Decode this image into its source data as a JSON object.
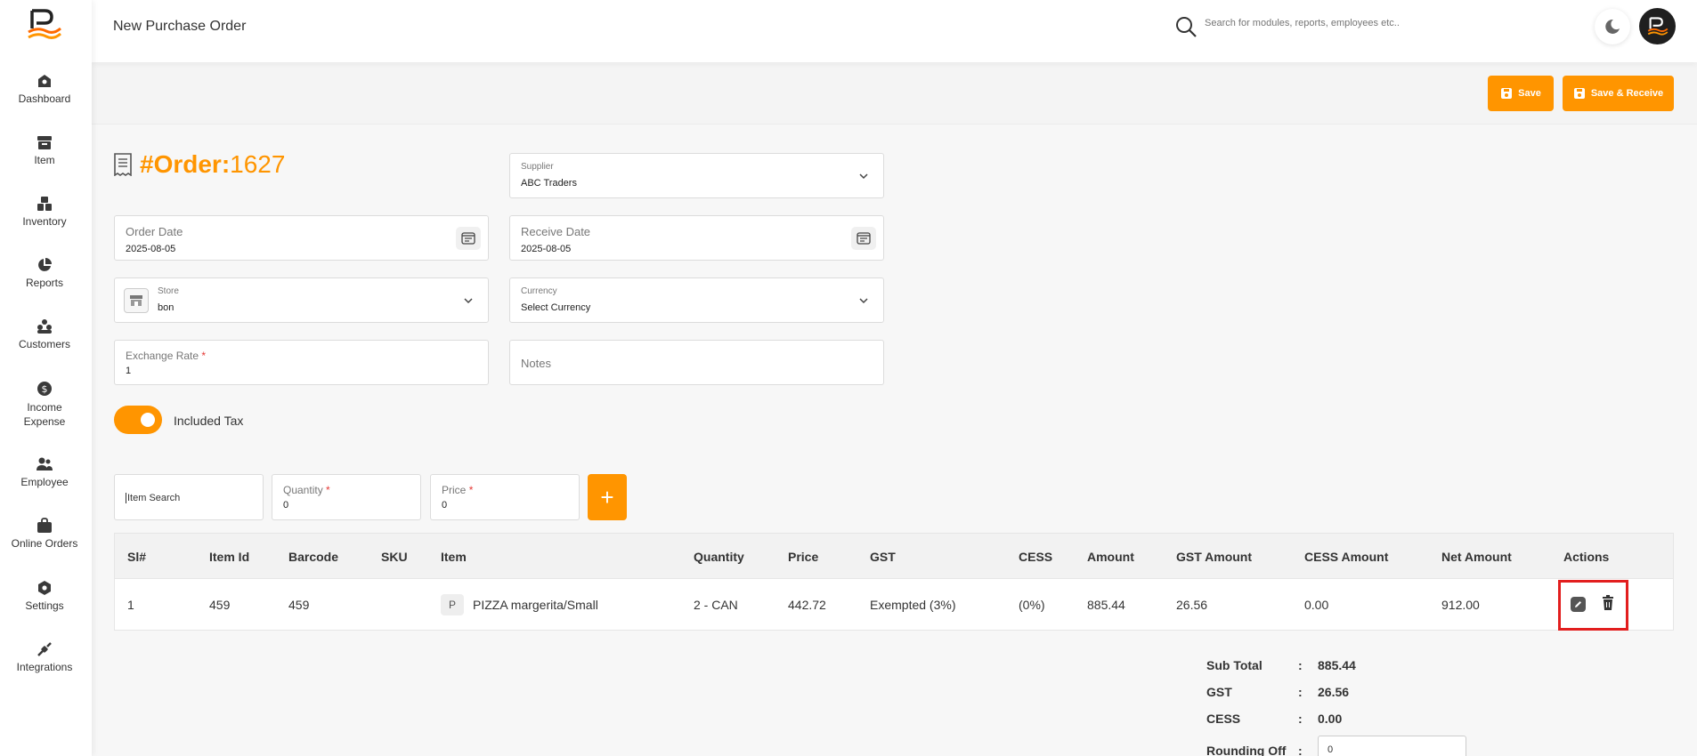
{
  "header": {
    "title": "New Purchase Order",
    "search_placeholder": "Search for modules, reports, employees etc.."
  },
  "sidebar": {
    "items": [
      {
        "label": "Dashboard",
        "icon": "dashboard-icon"
      },
      {
        "label": "Item",
        "icon": "item-icon"
      },
      {
        "label": "Inventory",
        "icon": "inventory-icon"
      },
      {
        "label": "Reports",
        "icon": "reports-icon"
      },
      {
        "label": "Customers",
        "icon": "customers-icon"
      },
      {
        "label": "Income Expense",
        "icon": "income-expense-icon"
      },
      {
        "label": "Employee",
        "icon": "employee-icon"
      },
      {
        "label": "Online Orders",
        "icon": "online-orders-icon"
      },
      {
        "label": "Settings",
        "icon": "settings-icon"
      },
      {
        "label": "Integrations",
        "icon": "integrations-icon"
      }
    ]
  },
  "actions": {
    "save": "Save",
    "save_receive": "Save & Receive"
  },
  "order": {
    "prefix": "#Order:",
    "number": "1627"
  },
  "form": {
    "supplier": {
      "label": "Supplier",
      "value": "ABC Traders"
    },
    "order_date": {
      "label": "Order Date",
      "value": "2025-08-05"
    },
    "receive_date": {
      "label": "Receive Date",
      "value": "2025-08-05"
    },
    "store": {
      "label": "Store",
      "value": "bon"
    },
    "currency": {
      "label": "Currency",
      "value": "Select Currency"
    },
    "exchange_rate": {
      "label": "Exchange Rate",
      "required": "*",
      "value": "1"
    },
    "notes": {
      "label": "Notes"
    },
    "included_tax": {
      "label": "Included Tax",
      "on": true
    }
  },
  "entry": {
    "item_search": {
      "placeholder": "Item Search"
    },
    "quantity": {
      "label": "Quantity",
      "required": "*",
      "value": "0"
    },
    "price": {
      "label": "Price",
      "required": "*",
      "value": "0"
    },
    "add": "+"
  },
  "table": {
    "headers": {
      "sl": "Sl#",
      "item_id": "Item Id",
      "barcode": "Barcode",
      "sku": "SKU",
      "item": "Item",
      "quantity": "Quantity",
      "price": "Price",
      "gst": "GST",
      "cess": "CESS",
      "amount": "Amount",
      "gst_amount": "GST Amount",
      "cess_amount": "CESS Amount",
      "net_amount": "Net Amount",
      "actions": "Actions"
    },
    "rows": [
      {
        "sl": "1",
        "item_id": "459",
        "barcode": "459",
        "sku": "",
        "badge": "P",
        "item": "PIZZA margerita/Small",
        "quantity": "2 - CAN",
        "price": "442.72",
        "gst": "Exempted (3%)",
        "cess": "(0%)",
        "amount": "885.44",
        "gst_amount": "26.56",
        "cess_amount": "0.00",
        "net_amount": "912.00"
      }
    ]
  },
  "totals": {
    "sub_total": {
      "label": "Sub Total",
      "value": "885.44"
    },
    "gst": {
      "label": "GST",
      "value": "26.56"
    },
    "cess": {
      "label": "CESS",
      "value": "0.00"
    },
    "rounding_off": {
      "label": "Rounding Off",
      "value": "0"
    },
    "sep": ":"
  },
  "colors": {
    "accent": "#ff9500",
    "highlight": "#e21e1e"
  }
}
